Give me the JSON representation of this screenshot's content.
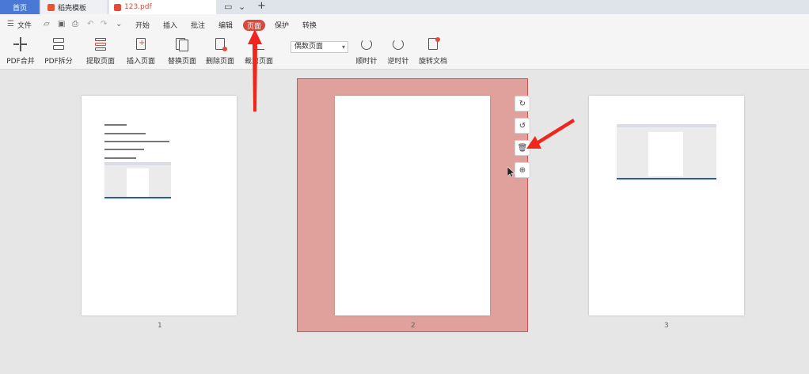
{
  "tabs": {
    "home": "首页",
    "templates": "稻壳模板",
    "document": "123.pdf",
    "new_tab": "+"
  },
  "menu": {
    "file": "文件",
    "items": [
      "开始",
      "插入",
      "批注",
      "编辑",
      "页面",
      "保护",
      "转换"
    ],
    "active": "页面"
  },
  "toolbar": {
    "pdf_merge": "PDF合并",
    "pdf_split": "PDF拆分",
    "extract_page": "提取页面",
    "insert_page": "插入页面",
    "replace_page": "替换页面",
    "delete_page": "删除页面",
    "crop_page": "裁剪页面",
    "page_select_value": "偶数页面",
    "clockwise": "顺时针",
    "counterclockwise": "逆时针",
    "rotate_document": "旋转文档"
  },
  "pages": {
    "numbers": [
      "1",
      "2",
      "3"
    ],
    "selected": "2"
  },
  "colors": {
    "accent_red": "#d54a3c",
    "selection_fill": "#e0a19c",
    "home_tab_blue": "#4a78d6"
  }
}
